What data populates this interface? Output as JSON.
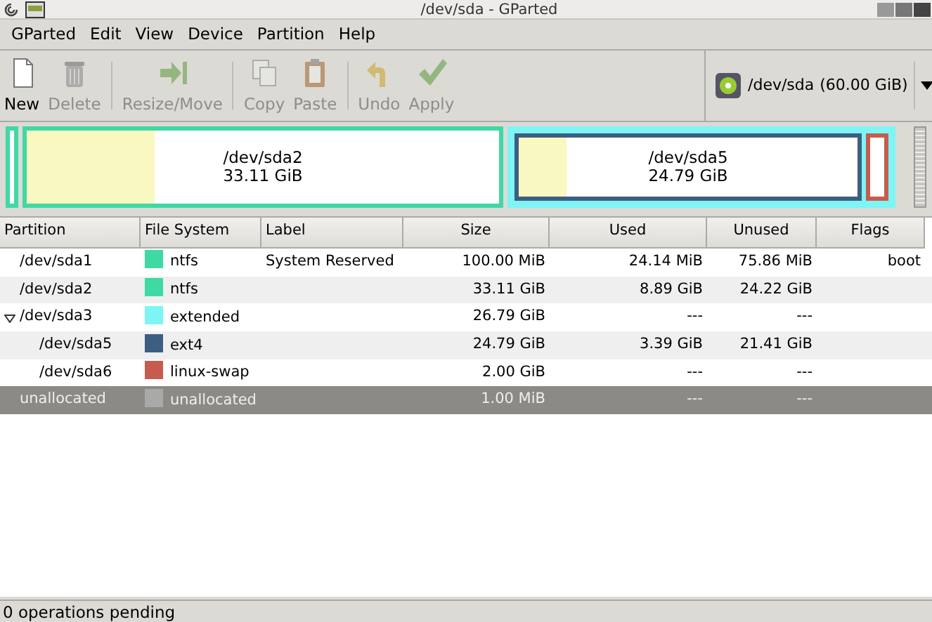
{
  "window": {
    "title": "/dev/sda - GParted"
  },
  "menu": [
    "GParted",
    "Edit",
    "View",
    "Device",
    "Partition",
    "Help"
  ],
  "toolbar": [
    {
      "kind": "new",
      "label": "New",
      "disabled": false
    },
    {
      "kind": "delete",
      "label": "Delete",
      "disabled": true
    },
    {
      "kind": "resize",
      "label": "Resize/Move",
      "disabled": true
    },
    {
      "kind": "copy",
      "label": "Copy",
      "disabled": true
    },
    {
      "kind": "paste",
      "label": "Paste",
      "disabled": true
    },
    {
      "kind": "undo",
      "label": "Undo",
      "disabled": true
    },
    {
      "kind": "apply",
      "label": "Apply",
      "disabled": true
    }
  ],
  "device": {
    "name": "/dev/sda",
    "size": "(60.00 GiB)"
  },
  "disk_map": [
    {
      "kind": "partition",
      "color": "#3fd9a3"
    },
    {
      "kind": "partition",
      "color": "#3fd9a3",
      "level": 0.27,
      "name": "/dev/sda2",
      "size": "33.11 GiB"
    },
    {
      "kind": "extended",
      "color": "#7df5f5",
      "children": [
        {
          "kind": "partition",
          "color": "#3e5d82",
          "level": 0.14,
          "name": "/dev/sda5",
          "size": "24.79 GiB"
        },
        {
          "kind": "partition",
          "color": "#c65c4e"
        }
      ]
    },
    {
      "kind": "unallocated"
    }
  ],
  "table": {
    "columns": [
      "Partition",
      "File System",
      "Label",
      "Size",
      "Used",
      "Unused",
      "Flags"
    ],
    "rows": [
      {
        "partition": "/dev/sda1",
        "file_system": "ntfs",
        "color": "#3fd9a3",
        "label": "System Reserved",
        "size": "100.00 MiB",
        "used": "24.14 MiB",
        "unused": "75.86 MiB",
        "flags": "boot",
        "selected": false
      },
      {
        "partition": "/dev/sda2",
        "file_system": "ntfs",
        "color": "#3fd9a3",
        "size": "33.11 GiB",
        "used": "8.89 GiB",
        "unused": "24.22 GiB",
        "selected": false
      },
      {
        "partition": "/dev/sda3",
        "file_system": "extended",
        "color": "#7df5f5",
        "size": "26.79 GiB",
        "used": "---",
        "unused": "---",
        "selected": false,
        "expanded": true,
        "children": [
          {
            "partition": "/dev/sda5",
            "file_system": "ext4",
            "color": "#3e5d82",
            "size": "24.79 GiB",
            "used": "3.39 GiB",
            "unused": "21.41 GiB",
            "selected": false
          },
          {
            "partition": "/dev/sda6",
            "file_system": "linux-swap",
            "color": "#c65c4e",
            "size": "2.00 GiB",
            "used": "---",
            "unused": "---",
            "selected": false
          }
        ]
      },
      {
        "partition": "unallocated",
        "file_system": "unallocated",
        "color": "#a9a9a9",
        "size": "1.00 MiB",
        "used": "---",
        "unused": "---",
        "selected": true
      }
    ]
  },
  "status_bar": "0 operations pending"
}
